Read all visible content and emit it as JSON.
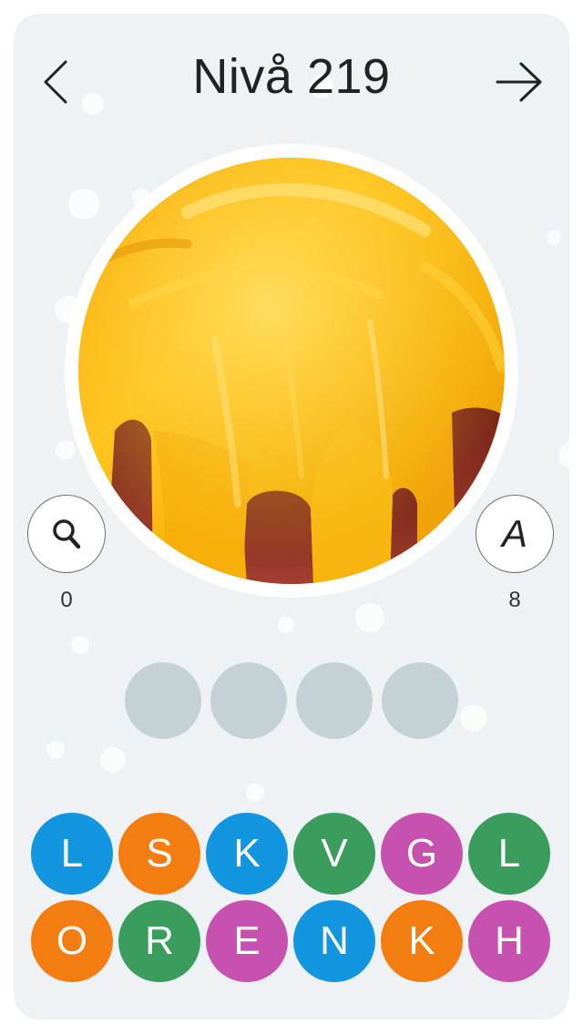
{
  "header": {
    "title": "Nivå 219"
  },
  "hints": {
    "reveal_count": "0",
    "letter_icon_glyph": "A",
    "letter_count": "8"
  },
  "answer": {
    "slots": [
      "",
      "",
      "",
      ""
    ]
  },
  "letters": {
    "row1": [
      "L",
      "S",
      "K",
      "V",
      "G",
      "L"
    ],
    "row2": [
      "O",
      "R",
      "E",
      "N",
      "K",
      "H"
    ]
  },
  "colors": {
    "background": "#eef2f4",
    "slot": "#c4d2d5",
    "blue": "#1296e0",
    "orange": "#f47d11",
    "green": "#3a9d5d",
    "magenta": "#c651ae"
  },
  "icons": {
    "back": "chevron-left-icon",
    "next": "arrow-right-icon",
    "reveal": "magnifier-icon",
    "letter": "letter-a-icon"
  }
}
